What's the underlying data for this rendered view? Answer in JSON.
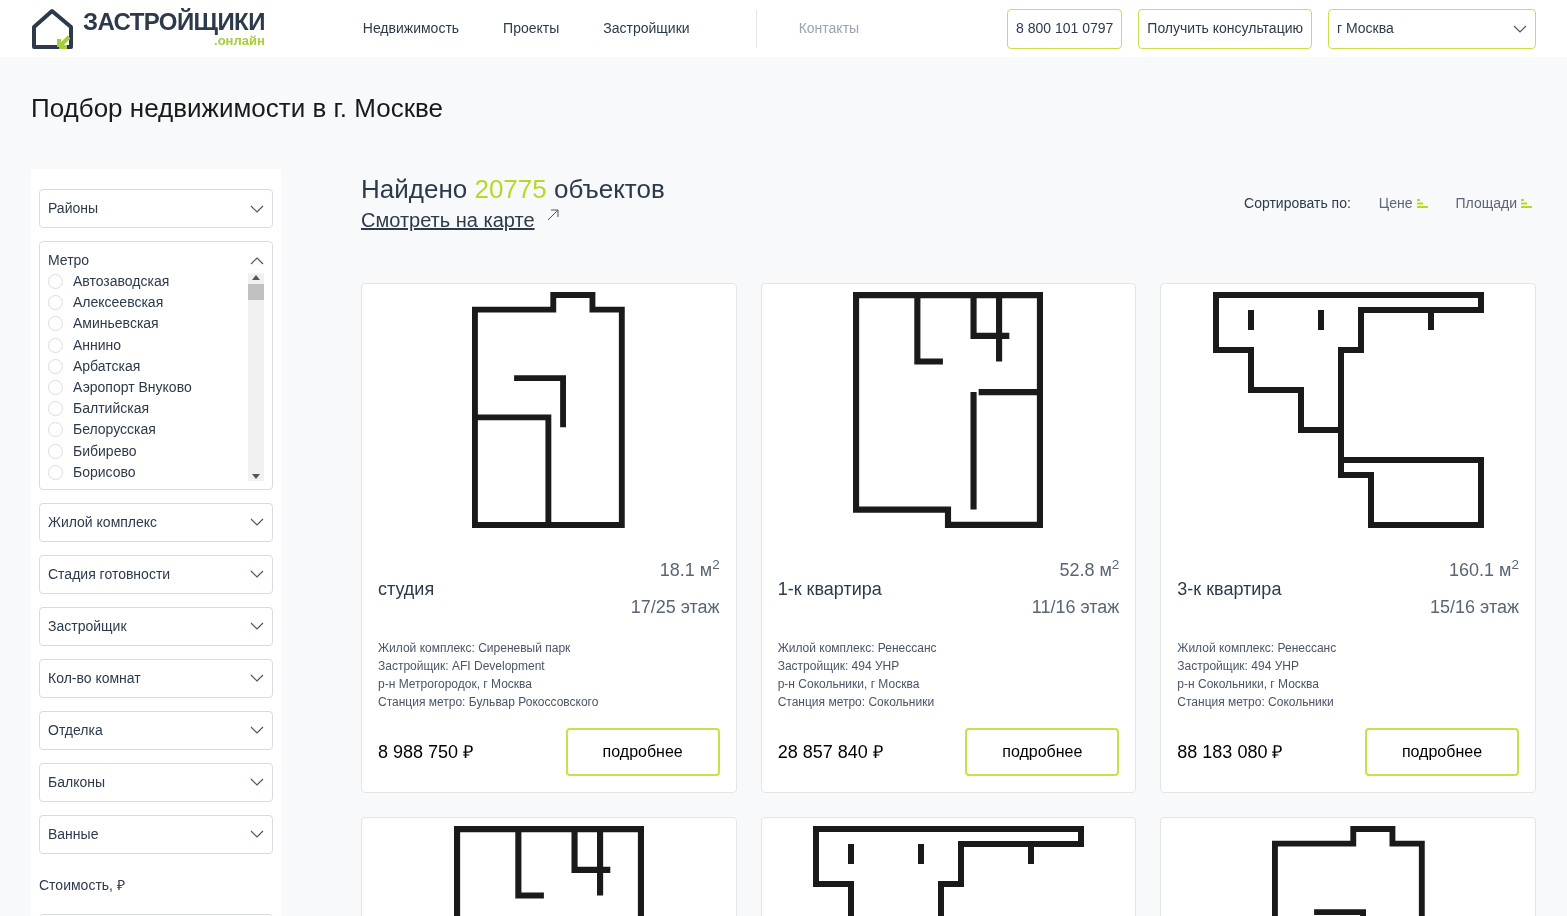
{
  "header": {
    "logo": {
      "name": "ЗАСТРОЙЩИКИ",
      "domain": ".онлайн"
    },
    "nav": [
      {
        "label": "Недвижимость",
        "muted": false
      },
      {
        "label": "Проекты",
        "muted": false
      },
      {
        "label": "Застройщики",
        "muted": false
      },
      {
        "label": "Контакты",
        "muted": true
      }
    ],
    "phone": "8 800 101 0797",
    "consult": "Получить консультацию",
    "city": "г Москва"
  },
  "page_title": "Подбор недвижимости в г. Москве",
  "filters": [
    {
      "kind": "select",
      "label": "Районы",
      "expanded": false
    },
    {
      "kind": "checklist",
      "label": "Метро",
      "expanded": true,
      "options": [
        {
          "label": "Автозаводская",
          "checked": false
        },
        {
          "label": "Алексеевская",
          "checked": false
        },
        {
          "label": "Аминьевская",
          "checked": false
        },
        {
          "label": "Аннино",
          "checked": false
        },
        {
          "label": "Арбатская",
          "checked": false
        },
        {
          "label": "Аэропорт Внуково",
          "checked": false
        },
        {
          "label": "Балтийская",
          "checked": false
        },
        {
          "label": "Белорусская",
          "checked": false
        },
        {
          "label": "Бибирево",
          "checked": false
        },
        {
          "label": "Борисово",
          "checked": false
        }
      ]
    },
    {
      "kind": "select",
      "label": "Жилой комплекс",
      "expanded": false
    },
    {
      "kind": "select",
      "label": "Стадия готовности",
      "expanded": false
    },
    {
      "kind": "select",
      "label": "Застройщик",
      "expanded": false
    },
    {
      "kind": "select",
      "label": "Кол-во комнат",
      "expanded": false
    },
    {
      "kind": "select",
      "label": "Отделка",
      "expanded": false
    },
    {
      "kind": "select",
      "label": "Балконы",
      "expanded": false
    },
    {
      "kind": "select",
      "label": "Ванные",
      "expanded": false
    },
    {
      "kind": "range",
      "label": "Стоимость, ₽"
    }
  ],
  "results": {
    "found_prefix": "Найдено",
    "found_count": "20775",
    "found_suffix": "объектов",
    "map_link": "Смотреть на карте",
    "sort_label": "Сортировать по:",
    "sort_options": [
      {
        "label": "Цене"
      },
      {
        "label": "Площади"
      }
    ]
  },
  "listings": [
    {
      "type": "студия",
      "area": "18.1 м$^{2}$",
      "floor": "17/25 этаж",
      "details": [
        "Жилой комплекс: Сиреневый парк",
        "Застройщик: AFI Development",
        "р-н Метрогородок, г Москва",
        "Станция метро: Бульвар Рокоссовского"
      ],
      "price": "8 988 750 ₽",
      "button": "подробнее"
    },
    {
      "type": "1-к квартира",
      "area": "52.8 м$^{2}$",
      "floor": "11/16 этаж",
      "details": [
        "Жилой комплекс: Ренессанс",
        "Застройщик: 494 УНР",
        "р-н Сокольники, г Москва",
        "Станция метро: Сокольники"
      ],
      "price": "28 857 840 ₽",
      "button": "подробнее"
    },
    {
      "type": "3-к квартира",
      "area": "160.1 м$^{2}$",
      "floor": "15/16 этаж",
      "details": [
        "Жилой комплекс: Ренессанс",
        "Застройщик: 494 УНР",
        "р-н Сокольники, г Москва",
        "Станция метро: Сокольники"
      ],
      "price": "88 183 080 ₽",
      "button": "подробнее"
    }
  ]
}
